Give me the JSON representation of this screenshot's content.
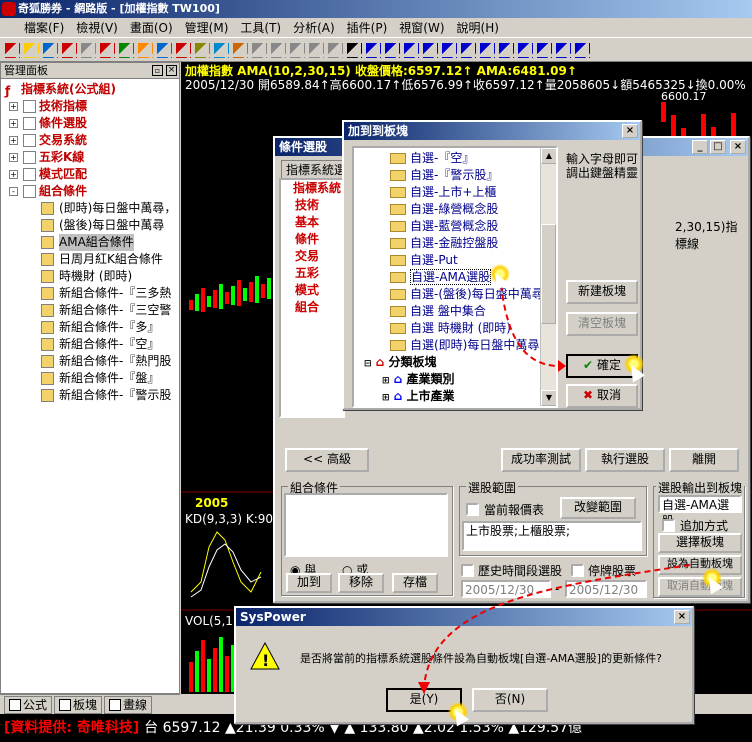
{
  "app": {
    "title": "奇狐勝券 - 網路版 - [加權指數 TW100]"
  },
  "menu": [
    "檔案(F)",
    "檢視(V)",
    "畫面(O)",
    "管理(M)",
    "工具(T)",
    "分析(A)",
    "插件(P)",
    "視窗(W)",
    "說明(H)"
  ],
  "left_panel": {
    "title": "管理面板",
    "nodes": [
      {
        "label": "指標系統(公式組)",
        "level": 0,
        "red": true
      },
      {
        "label": "技術指標",
        "level": 1,
        "pm": "+"
      },
      {
        "label": "條件選股",
        "level": 1,
        "pm": "+"
      },
      {
        "label": "交易系統",
        "level": 1,
        "pm": "+"
      },
      {
        "label": "五彩K線",
        "level": 1,
        "pm": "+"
      },
      {
        "label": "模式匹配",
        "level": 1,
        "pm": "+"
      },
      {
        "label": "組合條件",
        "level": 1,
        "pm": "-"
      },
      {
        "label": "(即時)每日盤中萬尋，",
        "level": 2
      },
      {
        "label": "(盤後)每日盤中萬尋",
        "level": 2
      },
      {
        "label": "AMA組合條件",
        "level": 2
      },
      {
        "label": "日周月紅K組合條件",
        "level": 2
      },
      {
        "label": "時機財 (即時)",
        "level": 2
      },
      {
        "label": "新組合條件-『三多熱",
        "level": 2
      },
      {
        "label": "新組合條件-『三空警",
        "level": 2
      },
      {
        "label": "新組合條件-『多』",
        "level": 2
      },
      {
        "label": "新組合條件-『空』",
        "level": 2
      },
      {
        "label": "新組合條件-『熱門股",
        "level": 2
      },
      {
        "label": "新組合條件-『盤』",
        "level": 2
      },
      {
        "label": "新組合條件-『警示股",
        "level": 2
      }
    ]
  },
  "tabs": [
    {
      "label": "公式"
    },
    {
      "label": "板塊"
    },
    {
      "label": "畫線"
    }
  ],
  "chart": {
    "header1": "加權指數  AMA(10,2,30,15)  收盤價格:6597.12↑ AMA:6481.09↑",
    "header2": "2005/12/30 開6589.84↑高6600.17↑低6576.99↑收6597.12↑量2058605↓額5465325↓換0.00%",
    "price_label": "6600.17",
    "year_label": "2005",
    "kd_label": "KD(9,3,3) K:90",
    "vol_label": "VOL(5,1"
  },
  "status": {
    "source": "[資料提供: 奇唯科技]",
    "quote": "台 6597.12 ▲21.39 0.33%  ▼  ▲ 133.80 ▲2.02 1.53%  ▲129.57億"
  },
  "cond_dialog": {
    "title": "條件選股",
    "tab": "指標系統選",
    "nodes": [
      "指標系統",
      "技術",
      "基本",
      "條件",
      "交易",
      "五彩",
      "模式",
      "組合"
    ],
    "right_text": "2,30,15)指標線",
    "btn_advanced": "<< 高級",
    "btn_success": "成功率測試",
    "btn_run": "執行選股",
    "btn_leave": "離開",
    "grp_combo": "組合條件",
    "radio_and": "與",
    "radio_or": "或",
    "btn_add": "加到",
    "btn_remove": "移除",
    "btn_save": "存檔",
    "grp_range": "選股範圍",
    "cb_current": "當前報價表",
    "btn_change": "改變範圍",
    "range_value": "上市股票;上櫃股票;",
    "cb_history": "歷史時間段選股",
    "cb_halt": "停牌股票",
    "date_from": "2005/12/30",
    "date_to": "2005/12/30",
    "grp_output": "選股輸出到板塊",
    "output_value": "自選-AMA選股",
    "cb_append": "追加方式",
    "btn_pick": "選擇板塊",
    "btn_auto": "設為自動板塊",
    "btn_cancel_auto": "取消自動板塊"
  },
  "add_dialog": {
    "title": "加到到板塊",
    "items": [
      "自選-『空』",
      "自選-『警示股』",
      "自選-上市+上櫃",
      "自選-綠營概念股",
      "自選-藍營概念股",
      "自選-金融控盤股",
      "自選-Put",
      "自選-AMA選股",
      "自選-(盤後)每日盤中萬尋",
      "自選  盤中集合",
      "自選  時機財  (即時)",
      "自選(即時)每日盤中萬尋"
    ],
    "category": "分類板塊",
    "sub1": "產業類別",
    "sub2": "上市產業",
    "hint": "輸入字母即可調出鍵盤精靈",
    "btn_new": "新建板塊",
    "btn_clear": "清空板塊",
    "btn_ok": "確定",
    "btn_cancel": "取消"
  },
  "msg_dialog": {
    "title": "SysPower",
    "message": "是否將當前的指標系統選股條件設為自動板塊[自選-AMA選股]的更新條件?",
    "btn_yes": "是(Y)",
    "btn_no": "否(N)"
  },
  "colors": {
    "title": "#0a246a",
    "red": "#c00000",
    "chart_bg": "#000000"
  }
}
